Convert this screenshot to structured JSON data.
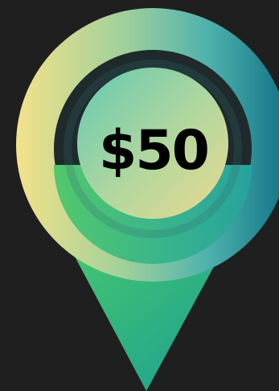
{
  "price_tag": {
    "amount": "$50"
  },
  "colors": {
    "background": "#1f1f1f",
    "pin_teal": "#147987",
    "pin_green": "#46bb72",
    "pin_yellow": "#efdd86",
    "ring_dark": "#1f2a2c",
    "text": "#000000"
  }
}
